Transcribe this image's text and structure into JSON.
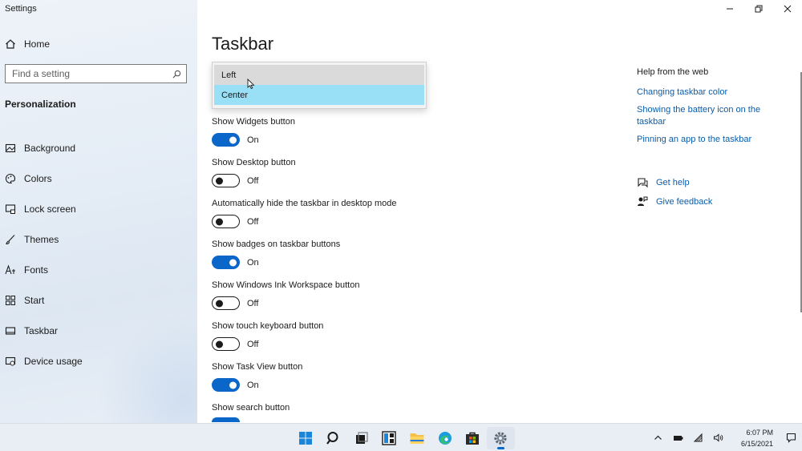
{
  "window": {
    "app_title": "Settings"
  },
  "sidebar": {
    "home_label": "Home",
    "search_placeholder": "Find a setting",
    "section_label": "Personalization",
    "items": [
      {
        "label": "Background",
        "icon": "image-icon"
      },
      {
        "label": "Colors",
        "icon": "palette-icon"
      },
      {
        "label": "Lock screen",
        "icon": "lock-screen-icon"
      },
      {
        "label": "Themes",
        "icon": "brush-icon"
      },
      {
        "label": "Fonts",
        "icon": "fonts-icon"
      },
      {
        "label": "Start",
        "icon": "start-grid-icon"
      },
      {
        "label": "Taskbar",
        "icon": "taskbar-icon"
      },
      {
        "label": "Device usage",
        "icon": "device-usage-icon"
      }
    ]
  },
  "main": {
    "title": "Taskbar",
    "dropdown": {
      "options": [
        "Left",
        "Center"
      ],
      "hovered": "Left",
      "selected": "Center"
    },
    "settings": [
      {
        "label": "Show Widgets button",
        "state": "On"
      },
      {
        "label": "Show Desktop button",
        "state": "Off"
      },
      {
        "label": "Automatically hide the taskbar in desktop mode",
        "state": "Off"
      },
      {
        "label": "Show badges on taskbar buttons",
        "state": "On"
      },
      {
        "label": "Show Windows Ink Workspace button",
        "state": "Off"
      },
      {
        "label": "Show touch keyboard button",
        "state": "Off"
      },
      {
        "label": "Show Task View button",
        "state": "On"
      },
      {
        "label": "Show search button",
        "state": "On"
      }
    ]
  },
  "help": {
    "title": "Help from the web",
    "links": [
      "Changing taskbar color",
      "Showing the battery icon on the taskbar",
      "Pinning an app to the taskbar"
    ],
    "get_help": "Get help",
    "give_feedback": "Give feedback"
  },
  "taskbar": {
    "apps": [
      "windows-start-icon",
      "search-icon",
      "task-view-icon",
      "widgets-icon",
      "file-explorer-icon",
      "edge-icon",
      "store-icon",
      "settings-gear-icon"
    ],
    "active_app": "settings-gear-icon",
    "time": "6:07 PM",
    "date": "6/15/2021"
  },
  "colors": {
    "accent": "#0a66c8",
    "link": "#0a5dab",
    "dropdown_selected": "#99e0f7"
  }
}
